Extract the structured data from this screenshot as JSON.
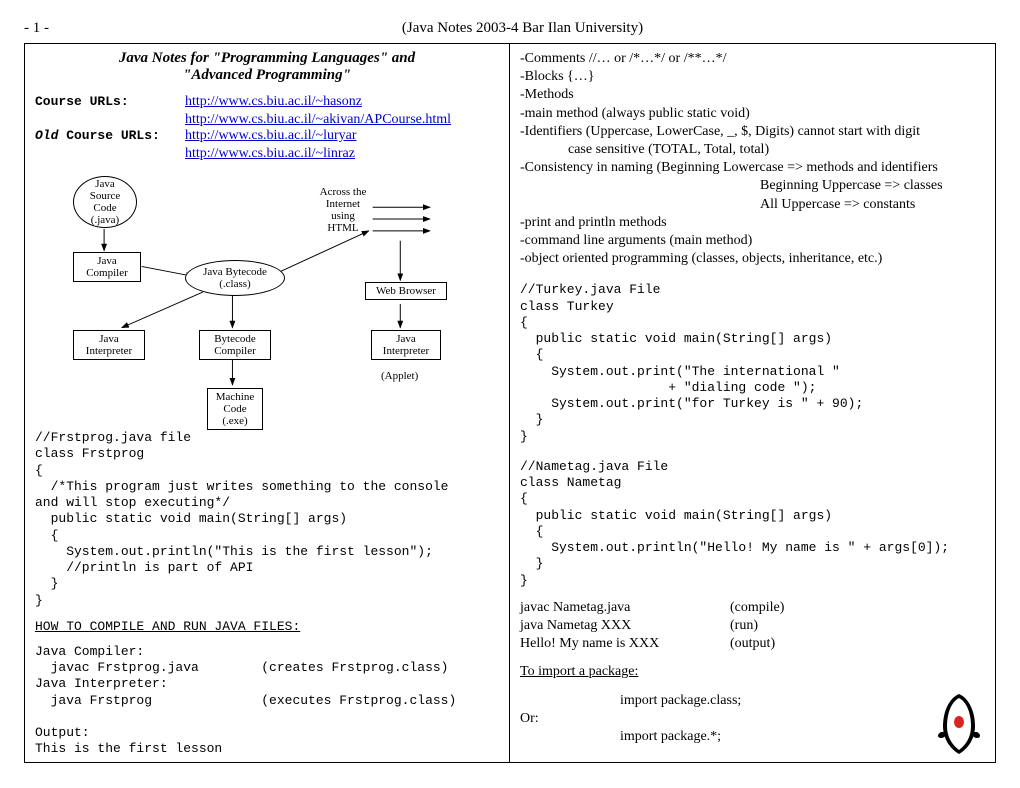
{
  "page_number": "- 1 -",
  "doc_header": "(Java Notes 2003-4 Bar Ilan University)",
  "title_line1": "Java Notes for \"Programming Languages\" and",
  "title_line2": "\"Advanced Programming\"",
  "course": {
    "label": "Course URLs:",
    "old_prefix": "Old",
    "old_label": " Course URLs:",
    "links": [
      "http://www.cs.biu.ac.il/~hasonz",
      "http://www.cs.biu.ac.il/~akivan/APCourse.html",
      "http://www.cs.biu.ac.il/~luryar",
      "http://www.cs.biu.ac.il/~linraz"
    ]
  },
  "diagram": {
    "source": "Java\nSource\nCode\n(.java)",
    "compiler": "Java\nCompiler",
    "bytecode": "Java Bytecode\n(.class)",
    "interpreter1": "Java\nInterpreter",
    "bytecode_compiler": "Bytecode\nCompiler",
    "machine_code": "Machine\nCode\n(.exe)",
    "across": "Across the\nInternet\nusing\nHTML",
    "web_browser": "Web Browser",
    "interpreter2": "Java\nInterpreter",
    "applet": "(Applet)"
  },
  "frstprog_code": "//Frstprog.java file\nclass Frstprog\n{\n  /*This program just writes something to the console\nand will stop executing*/\n  public static void main(String[] args)\n  {\n    System.out.println(\"This is the first lesson\");\n    //println is part of API\n  }\n}",
  "howto_heading": "HOW TO COMPILE AND RUN JAVA FILES:",
  "howto_block": "Java Compiler:\n  javac Frstprog.java        (creates Frstprog.class)\nJava Interpreter:\n  java Frstprog              (executes Frstprog.class)\n\nOutput:\nThis is the first lesson",
  "bullets": {
    "comments": "-Comments //… or /*…*/ or /**…*/",
    "blocks": "-Blocks {…}",
    "methods": "-Methods",
    "main": "-main method (always public static void)",
    "identifiers": "-Identifiers (Uppercase, LowerCase, _, $, Digits) cannot start with digit",
    "case_sensitive": "case sensitive (TOTAL, Total, total)",
    "consistency": "-Consistency in naming (Beginning Lowercase => methods and identifiers",
    "beg_upper": "Beginning Uppercase => classes",
    "all_upper": "All     Uppercase => constants",
    "print": "-print and println methods",
    "cmdline": "-command line arguments (main method)",
    "oop": "-object oriented programming (classes, objects, inheritance, etc.)"
  },
  "turkey_code": "//Turkey.java File\nclass Turkey\n{\n  public static void main(String[] args)\n  {\n    System.out.print(\"The international \"\n                   + \"dialing code \");\n    System.out.print(\"for Turkey is \" + 90);\n  }\n}",
  "nametag_code": "//Nametag.java File\nclass Nametag\n{\n  public static void main(String[] args)\n  {\n    System.out.println(\"Hello! My name is \" + args[0]);\n  }\n}",
  "cmd_rows": [
    {
      "cmd": "javac Nametag.java",
      "note": "(compile)"
    },
    {
      "cmd": "java Nametag XXX",
      "note": "(run)"
    },
    {
      "cmd": "Hello! My name is XXX",
      "note": "(output)"
    }
  ],
  "import_heading": "To import a package:",
  "import_line1": "import package.class;",
  "import_or": "Or:",
  "import_line2": "import package.*;"
}
